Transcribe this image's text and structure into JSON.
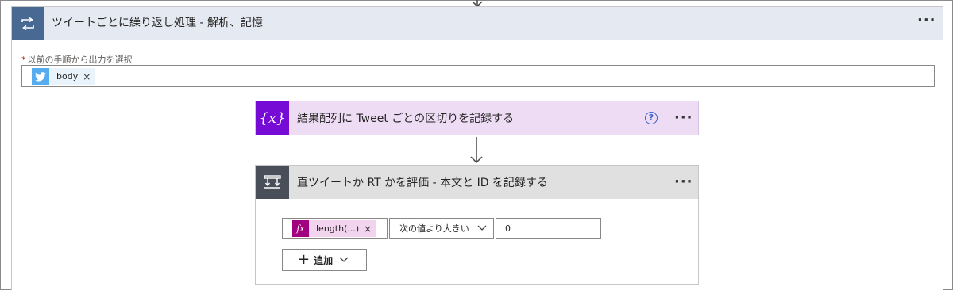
{
  "loop": {
    "title": "ツイートごとに繰り返し処理 - 解析、記憶",
    "icon": "loop-icon",
    "more": "···",
    "select_required_mark": "*",
    "select_label": "以前の手順から出力を選択",
    "token": {
      "label": "body",
      "remove": "×",
      "icon": "twitter-icon"
    }
  },
  "variable_action": {
    "title": "結果配列に Tweet ごとの区切りを記録する",
    "icon": "variable-icon",
    "icon_text": "{x}",
    "help": "?",
    "more": "···"
  },
  "condition": {
    "title": "直ツイートか RT かを評価 - 本文と ID を記録する",
    "icon": "condition-icon",
    "more": "···",
    "operand": {
      "icon_text": "fx",
      "label": "length(...)",
      "remove": "×"
    },
    "operator": "次の値より大きい",
    "value": "0",
    "add_label": "追加"
  },
  "colors": {
    "loop_accent": "#486991",
    "loop_header_bg": "#e5e9f1",
    "variable_accent": "#770bd6",
    "variable_bg": "#eedcf5",
    "condition_accent": "#484f58",
    "condition_header_bg": "#e0e0e0",
    "twitter": "#55acee",
    "expression": "#a1007f"
  }
}
